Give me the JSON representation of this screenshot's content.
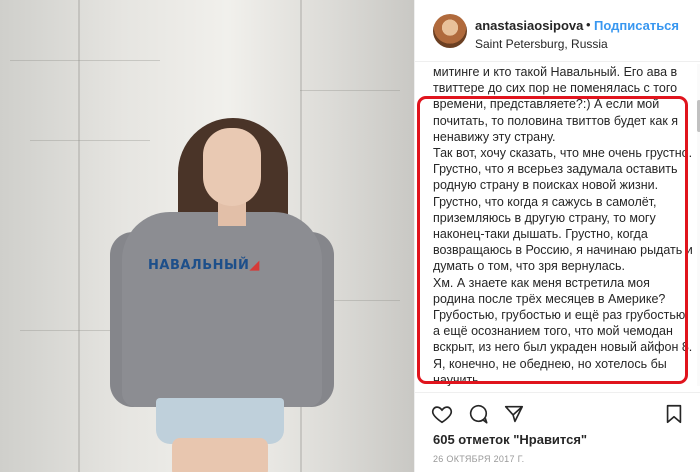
{
  "photo": {
    "shirt_text": "НАВАЛЬНЫЙ",
    "brand_blue": "#1d4f8a",
    "brand_red": "#d63a37"
  },
  "post": {
    "username": "anastasiaosipova",
    "separator": "•",
    "follow_label": "Подписаться",
    "location": "Saint Petersburg, Russia",
    "caption_paragraphs": [
      "митинге и кто такой Навальный. Его ава в твиттере до сих пор не поменялась с того времени, представляете?:) А если мой почитать, то половина твиттов будет как я ненавижу эту страну.",
      "Так вот, хочу сказать, что мне очень грустно. Грустно, что я всерьез задумала оставить родную страну в поисках новой жизни. Грустно, что когда я сажусь в самолёт, приземляюсь в другую страну, то могу наконец-таки дышать. Грустно, когда возвращаюсь в Россию, я начинаю рыдать и думать о том, что зря вернулась.",
      "Хм. А знаете как меня встретила моя родина после трёх месяцев в Америке? Грубостью, грубостью и ещё раз грубостью, а ещё осознанием того, что мой чемодан вскрыт, из него был украден новый айфон 8. Я, конечно, не обеднею, но хотелось бы научить"
    ],
    "likes_label": "605 отметок \"Нравится\"",
    "date_label": "26 ОКТЯБРЯ 2017 Г.",
    "icons": [
      "heart-icon",
      "comment-icon",
      "share-icon",
      "bookmark-icon"
    ],
    "highlight_color": "#e0141d",
    "link_color": "#3897f0"
  }
}
